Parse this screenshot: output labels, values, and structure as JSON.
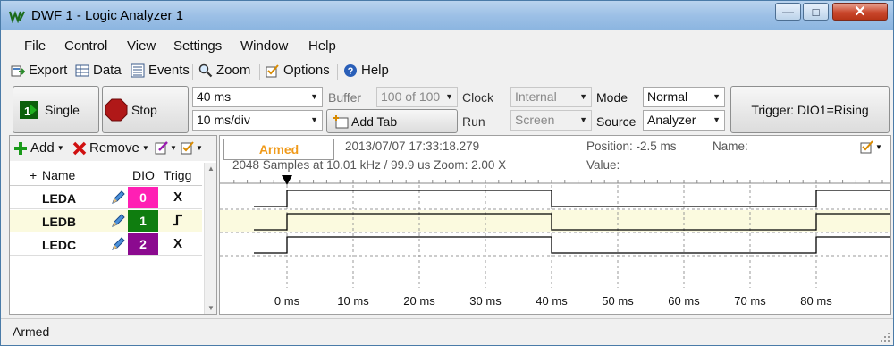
{
  "window": {
    "title": "DWF 1 - Logic Analyzer 1"
  },
  "menu": [
    "File",
    "Control",
    "View",
    "Settings",
    "Window",
    "Help"
  ],
  "toolbar": {
    "export": "Export",
    "data": "Data",
    "events": "Events",
    "zoom": "Zoom",
    "options": "Options",
    "help": "Help"
  },
  "controls": {
    "single": "Single",
    "stop": "Stop",
    "time_position": "40 ms",
    "time_base": "10 ms/div",
    "buffer_label": "Buffer",
    "buffer_value": "100 of 100",
    "add_tab": "Add Tab",
    "clock_label": "Clock",
    "clock_value": "Internal",
    "run_label": "Run",
    "run_value": "Screen",
    "mode_label": "Mode",
    "mode_value": "Normal",
    "source_label": "Source",
    "source_value": "Analyzer",
    "trigger": "Trigger: DIO1=Rising"
  },
  "channels_panel": {
    "add": "Add",
    "remove": "Remove",
    "headers": {
      "expand": "+",
      "name": "Name",
      "dio": "DIO",
      "trigger": "Trigg"
    },
    "rows": [
      {
        "name": "LEDA",
        "dio": "0",
        "dio_color": "#ff1fb4",
        "trigger": "X"
      },
      {
        "name": "LEDB",
        "dio": "1",
        "dio_color": "#0f7d0f",
        "trigger": "rising"
      },
      {
        "name": "LEDC",
        "dio": "2",
        "dio_color": "#8b0a8f",
        "trigger": "X"
      }
    ]
  },
  "plot": {
    "state": "Armed",
    "datetime": "2013/07/07  17:33:18.279",
    "samples": "2048 Samples at 10.01 kHz / 99.9 us Zoom: 2.00 X",
    "position": "Position: -2.5 ms",
    "name": "Name:",
    "value": "Value:",
    "time_labels": [
      "0 ms",
      "10 ms",
      "20 ms",
      "30 ms",
      "40 ms",
      "50 ms",
      "60 ms",
      "70 ms",
      "80 ms"
    ],
    "signals": {
      "LEDA": [
        [
          -5,
          0
        ],
        [
          0,
          0
        ],
        [
          0,
          1
        ],
        [
          40,
          1
        ],
        [
          40,
          0
        ],
        [
          80,
          0
        ],
        [
          80,
          1
        ],
        [
          92,
          1
        ]
      ],
      "LEDB": [
        [
          -5,
          0
        ],
        [
          0,
          0
        ],
        [
          0,
          1
        ],
        [
          40,
          1
        ],
        [
          40,
          0
        ],
        [
          80,
          0
        ],
        [
          80,
          1
        ],
        [
          92,
          1
        ]
      ],
      "LEDC": [
        [
          -5,
          0
        ],
        [
          0,
          0
        ],
        [
          0,
          1
        ],
        [
          40,
          1
        ],
        [
          40,
          0
        ],
        [
          80,
          0
        ],
        [
          80,
          1
        ],
        [
          92,
          1
        ]
      ]
    }
  },
  "status": "Armed"
}
